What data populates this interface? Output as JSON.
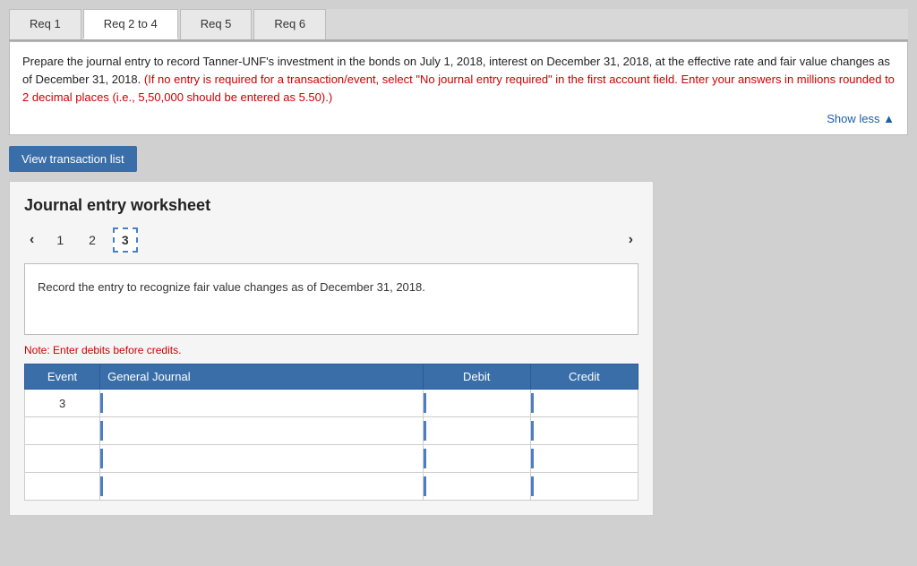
{
  "tabs": [
    {
      "label": "Req 1",
      "active": false
    },
    {
      "label": "Req 2 to 4",
      "active": false
    },
    {
      "label": "Req 5",
      "active": false
    },
    {
      "label": "Req 6",
      "active": false
    }
  ],
  "instruction": {
    "main": "Prepare the journal entry to record Tanner-UNF's investment in the bonds on July 1, 2018, interest on December 31, 2018, at the effective rate and fair value changes as of December 31, 2018.",
    "red": "(If no entry is required for a transaction/event, select \"No journal entry required\" in the first account field.  Enter your answers in millions rounded to 2 decimal places (i.e., 5,50,000 should be entered as 5.50).)",
    "show_less": "Show less ▲"
  },
  "btn_view_transaction": "View transaction list",
  "worksheet": {
    "title": "Journal entry worksheet",
    "steps": [
      "1",
      "2",
      "3"
    ],
    "active_step": 2,
    "entry_description": "Record the entry to recognize fair value changes as of December 31, 2018.",
    "note": "Note: Enter debits before credits.",
    "table": {
      "headers": [
        "Event",
        "General Journal",
        "Debit",
        "Credit"
      ],
      "rows": [
        {
          "event": "3",
          "journal": "",
          "debit": "",
          "credit": ""
        },
        {
          "event": "",
          "journal": "",
          "debit": "",
          "credit": ""
        },
        {
          "event": "",
          "journal": "",
          "debit": "",
          "credit": ""
        },
        {
          "event": "",
          "journal": "",
          "debit": "",
          "credit": ""
        }
      ]
    }
  }
}
